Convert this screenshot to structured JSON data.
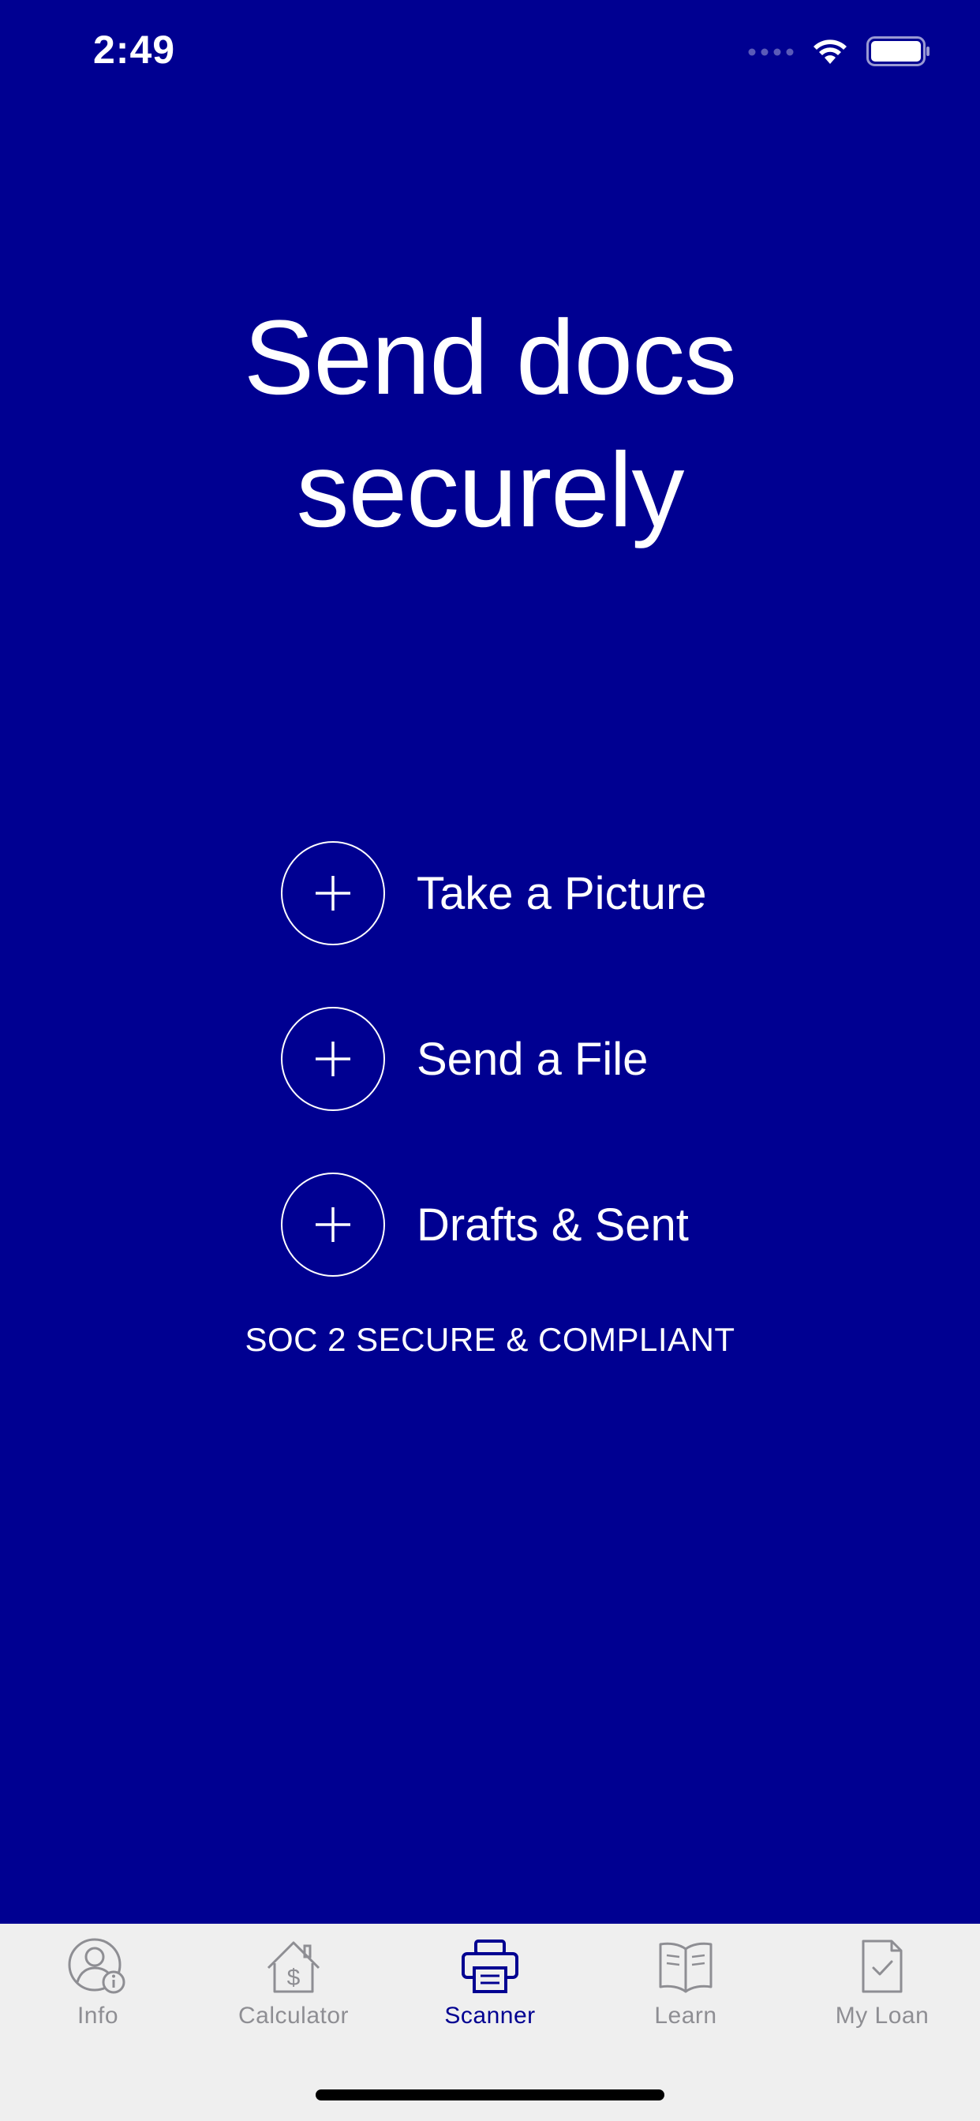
{
  "status_bar": {
    "time": "2:49",
    "signal_icon": "signal-dots-icon",
    "wifi_icon": "wifi-icon",
    "battery_icon": "battery-icon"
  },
  "hero": {
    "title_line1": "Send docs",
    "title_line2": "securely"
  },
  "actions": [
    {
      "label": "Take a Picture",
      "icon": "plus-icon"
    },
    {
      "label": "Send a File",
      "icon": "plus-icon"
    },
    {
      "label": "Drafts & Sent",
      "icon": "plus-icon"
    }
  ],
  "compliance_text": "SOC 2 SECURE & COMPLIANT",
  "tab_bar": {
    "active": "Scanner",
    "tabs": [
      {
        "label": "Info",
        "icon": "person-info-icon"
      },
      {
        "label": "Calculator",
        "icon": "house-dollar-icon"
      },
      {
        "label": "Scanner",
        "icon": "scanner-printer-icon"
      },
      {
        "label": "Learn",
        "icon": "open-book-icon"
      },
      {
        "label": "My Loan",
        "icon": "document-check-icon"
      }
    ]
  },
  "colors": {
    "background": "#000091",
    "foreground": "#ffffff",
    "tab_bar_bg": "#efefef",
    "tab_inactive": "#8e8e93",
    "tab_active": "#000091"
  }
}
